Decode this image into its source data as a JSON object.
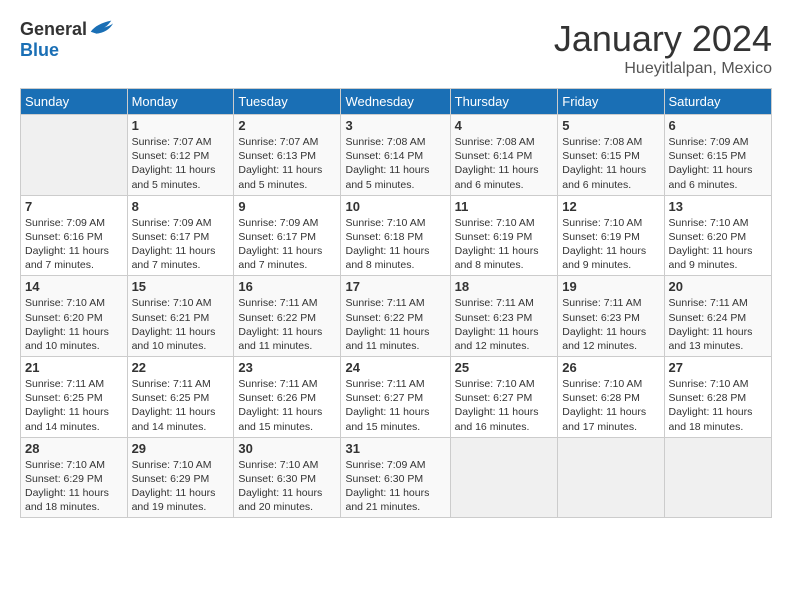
{
  "header": {
    "logo_general": "General",
    "logo_blue": "Blue",
    "month_title": "January 2024",
    "location": "Hueyitlalpan, Mexico"
  },
  "weekdays": [
    "Sunday",
    "Monday",
    "Tuesday",
    "Wednesday",
    "Thursday",
    "Friday",
    "Saturday"
  ],
  "weeks": [
    [
      {
        "day": "",
        "info": ""
      },
      {
        "day": "1",
        "info": "Sunrise: 7:07 AM\nSunset: 6:12 PM\nDaylight: 11 hours\nand 5 minutes."
      },
      {
        "day": "2",
        "info": "Sunrise: 7:07 AM\nSunset: 6:13 PM\nDaylight: 11 hours\nand 5 minutes."
      },
      {
        "day": "3",
        "info": "Sunrise: 7:08 AM\nSunset: 6:14 PM\nDaylight: 11 hours\nand 5 minutes."
      },
      {
        "day": "4",
        "info": "Sunrise: 7:08 AM\nSunset: 6:14 PM\nDaylight: 11 hours\nand 6 minutes."
      },
      {
        "day": "5",
        "info": "Sunrise: 7:08 AM\nSunset: 6:15 PM\nDaylight: 11 hours\nand 6 minutes."
      },
      {
        "day": "6",
        "info": "Sunrise: 7:09 AM\nSunset: 6:15 PM\nDaylight: 11 hours\nand 6 minutes."
      }
    ],
    [
      {
        "day": "7",
        "info": "Sunrise: 7:09 AM\nSunset: 6:16 PM\nDaylight: 11 hours\nand 7 minutes."
      },
      {
        "day": "8",
        "info": "Sunrise: 7:09 AM\nSunset: 6:17 PM\nDaylight: 11 hours\nand 7 minutes."
      },
      {
        "day": "9",
        "info": "Sunrise: 7:09 AM\nSunset: 6:17 PM\nDaylight: 11 hours\nand 7 minutes."
      },
      {
        "day": "10",
        "info": "Sunrise: 7:10 AM\nSunset: 6:18 PM\nDaylight: 11 hours\nand 8 minutes."
      },
      {
        "day": "11",
        "info": "Sunrise: 7:10 AM\nSunset: 6:19 PM\nDaylight: 11 hours\nand 8 minutes."
      },
      {
        "day": "12",
        "info": "Sunrise: 7:10 AM\nSunset: 6:19 PM\nDaylight: 11 hours\nand 9 minutes."
      },
      {
        "day": "13",
        "info": "Sunrise: 7:10 AM\nSunset: 6:20 PM\nDaylight: 11 hours\nand 9 minutes."
      }
    ],
    [
      {
        "day": "14",
        "info": "Sunrise: 7:10 AM\nSunset: 6:20 PM\nDaylight: 11 hours\nand 10 minutes."
      },
      {
        "day": "15",
        "info": "Sunrise: 7:10 AM\nSunset: 6:21 PM\nDaylight: 11 hours\nand 10 minutes."
      },
      {
        "day": "16",
        "info": "Sunrise: 7:11 AM\nSunset: 6:22 PM\nDaylight: 11 hours\nand 11 minutes."
      },
      {
        "day": "17",
        "info": "Sunrise: 7:11 AM\nSunset: 6:22 PM\nDaylight: 11 hours\nand 11 minutes."
      },
      {
        "day": "18",
        "info": "Sunrise: 7:11 AM\nSunset: 6:23 PM\nDaylight: 11 hours\nand 12 minutes."
      },
      {
        "day": "19",
        "info": "Sunrise: 7:11 AM\nSunset: 6:23 PM\nDaylight: 11 hours\nand 12 minutes."
      },
      {
        "day": "20",
        "info": "Sunrise: 7:11 AM\nSunset: 6:24 PM\nDaylight: 11 hours\nand 13 minutes."
      }
    ],
    [
      {
        "day": "21",
        "info": "Sunrise: 7:11 AM\nSunset: 6:25 PM\nDaylight: 11 hours\nand 14 minutes."
      },
      {
        "day": "22",
        "info": "Sunrise: 7:11 AM\nSunset: 6:25 PM\nDaylight: 11 hours\nand 14 minutes."
      },
      {
        "day": "23",
        "info": "Sunrise: 7:11 AM\nSunset: 6:26 PM\nDaylight: 11 hours\nand 15 minutes."
      },
      {
        "day": "24",
        "info": "Sunrise: 7:11 AM\nSunset: 6:27 PM\nDaylight: 11 hours\nand 15 minutes."
      },
      {
        "day": "25",
        "info": "Sunrise: 7:10 AM\nSunset: 6:27 PM\nDaylight: 11 hours\nand 16 minutes."
      },
      {
        "day": "26",
        "info": "Sunrise: 7:10 AM\nSunset: 6:28 PM\nDaylight: 11 hours\nand 17 minutes."
      },
      {
        "day": "27",
        "info": "Sunrise: 7:10 AM\nSunset: 6:28 PM\nDaylight: 11 hours\nand 18 minutes."
      }
    ],
    [
      {
        "day": "28",
        "info": "Sunrise: 7:10 AM\nSunset: 6:29 PM\nDaylight: 11 hours\nand 18 minutes."
      },
      {
        "day": "29",
        "info": "Sunrise: 7:10 AM\nSunset: 6:29 PM\nDaylight: 11 hours\nand 19 minutes."
      },
      {
        "day": "30",
        "info": "Sunrise: 7:10 AM\nSunset: 6:30 PM\nDaylight: 11 hours\nand 20 minutes."
      },
      {
        "day": "31",
        "info": "Sunrise: 7:09 AM\nSunset: 6:30 PM\nDaylight: 11 hours\nand 21 minutes."
      },
      {
        "day": "",
        "info": ""
      },
      {
        "day": "",
        "info": ""
      },
      {
        "day": "",
        "info": ""
      }
    ]
  ]
}
